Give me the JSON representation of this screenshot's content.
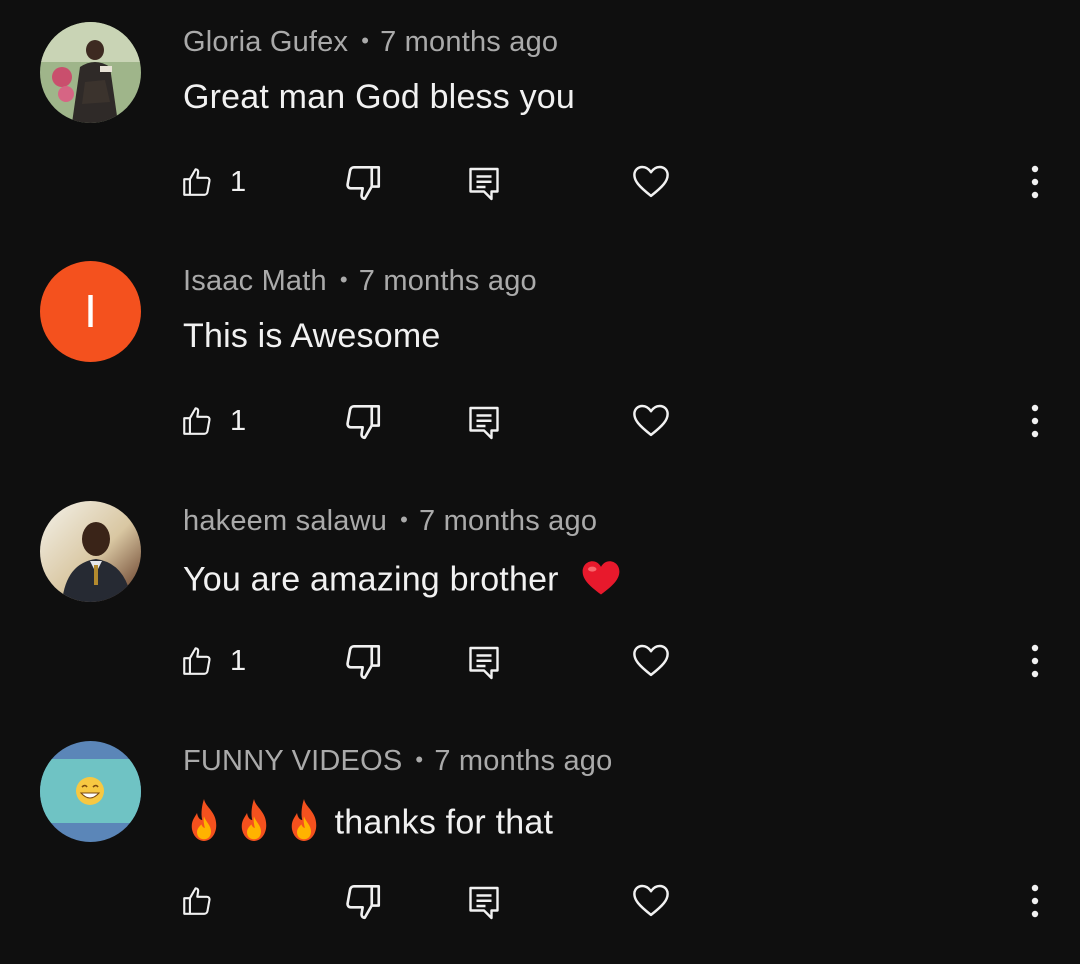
{
  "comments": [
    {
      "author": "Gloria Gufex",
      "time": "7 months ago",
      "text": "Great man God bless you",
      "likes": "1",
      "emoji_after": "",
      "emoji_before": [],
      "avatar_icon": "photo-woman"
    },
    {
      "author": "Isaac Math",
      "time": "7 months ago",
      "text": "This is Awesome",
      "likes": "1",
      "emoji_after": "",
      "emoji_before": [],
      "avatar_letter": "I",
      "avatar_color": "#f4511e"
    },
    {
      "author": "hakeem salawu",
      "time": "7 months ago",
      "text": "You are amazing brother",
      "likes": "1",
      "emoji_after": "❤️",
      "emoji_before": [],
      "avatar_icon": "photo-man"
    },
    {
      "author": "FUNNY VIDEOS",
      "time": "7 months ago",
      "text": "thanks for that",
      "likes": "",
      "emoji_after": "",
      "emoji_before": [
        "🔥",
        "🔥",
        "🔥"
      ],
      "avatar_icon": "grinning-face",
      "avatar_color": "#6fc3c4"
    }
  ],
  "separator": "•",
  "icons": {
    "like": "thumbs-up-icon",
    "dislike": "thumbs-down-icon",
    "reply": "reply-icon",
    "heart": "heart-icon",
    "more": "more-vert-icon"
  },
  "colors": {
    "background": "#0f0f0f",
    "text": "#f1f1f1",
    "meta": "#aaaaaa"
  }
}
